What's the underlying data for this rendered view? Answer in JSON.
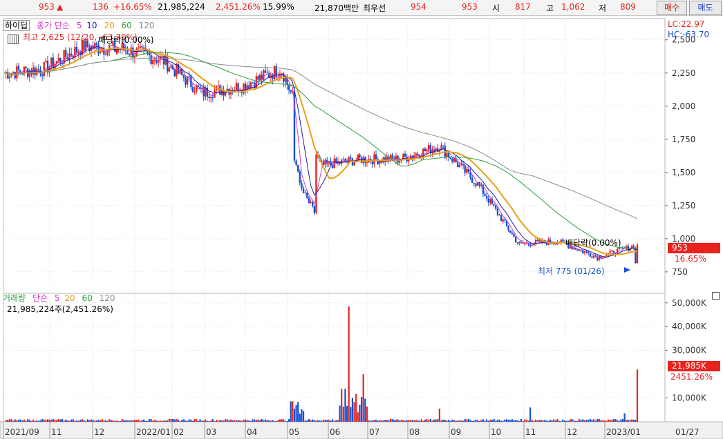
{
  "quote": {
    "price": "953",
    "arrow": "▲",
    "change": "136",
    "change_pct": "+16.65%",
    "volume": "21,985,224",
    "volume_pct": "2,451.26%",
    "turnover": "15.99%",
    "amount": "21,870백만",
    "bid_label": "최우선",
    "ask_price": "954",
    "bid_price": "953",
    "open_label": "시",
    "open": "817",
    "high_label": "고",
    "high": "1,062",
    "low_label": "저",
    "low": "809"
  },
  "buttons": {
    "buy": "매수",
    "sell": "매도"
  },
  "price_legend": {
    "name": "하이딥",
    "type": "종가 단순",
    "ma5": "5",
    "ma10": "10",
    "ma20": "20",
    "ma60": "60",
    "ma120": "120"
  },
  "vol_legend": {
    "name": "거래량",
    "type": "단순",
    "ma5": "5",
    "ma20": "20",
    "ma60": "60",
    "ma120": "120",
    "value": "21,985,224주(2,451.26%)"
  },
  "annotations": {
    "high": "최고 2,625 (12/20, -63.70%)",
    "low": "최저 775 (01/26)",
    "ex_div1": "배당락(0.00%)",
    "ex_div2": "배당락(0.00%)",
    "lc": "LC:22.97",
    "hc": "HC:-63.70",
    "last_price": "953",
    "last_pct": "16.65%",
    "last_vol": "21,985K",
    "last_vol_pct": "2451.26%"
  },
  "colors": {
    "up": "#e8231e",
    "down": "#1450d2",
    "ma5": "#d23cc8",
    "ma10": "#1e1ea0",
    "ma20": "#e6a014",
    "ma60": "#28a03c",
    "ma120": "#8c8c8c"
  },
  "chart_data": [
    {
      "type": "candlestick",
      "yticks": [
        "2,500",
        "2,250",
        "2,000",
        "1,750",
        "1,500",
        "1,250",
        "1,000",
        "750"
      ],
      "ylim": [
        640,
        2660
      ],
      "xticks": [
        "2021/09",
        "11",
        "12",
        "2022/01",
        "02",
        "03",
        "04",
        "05",
        "06",
        "07",
        "08",
        "09",
        "10",
        "11",
        "12",
        "2023/01",
        "01/27"
      ],
      "monthly_close": {
        "x": [
          "2021/09",
          "2021/10",
          "2021/11",
          "2021/12",
          "2022/01",
          "2022/02",
          "2022/03",
          "2022/04",
          "2022/05",
          "2022/06",
          "2022/07",
          "2022/08",
          "2022/09",
          "2022/10",
          "2022/11",
          "2022/12",
          "2023/01"
        ],
        "y": [
          2250,
          2280,
          2450,
          2430,
          2350,
          2100,
          2150,
          2280,
          1550,
          1600,
          1600,
          1700,
          1400,
          960,
          980,
          860,
          953
        ]
      }
    },
    {
      "type": "bar",
      "name": "거래량",
      "yticks": [
        "50,000K",
        "40,000K",
        "30,000K",
        "10,000K"
      ],
      "ylim": [
        0,
        54000
      ],
      "last_value": 21985224
    }
  ]
}
